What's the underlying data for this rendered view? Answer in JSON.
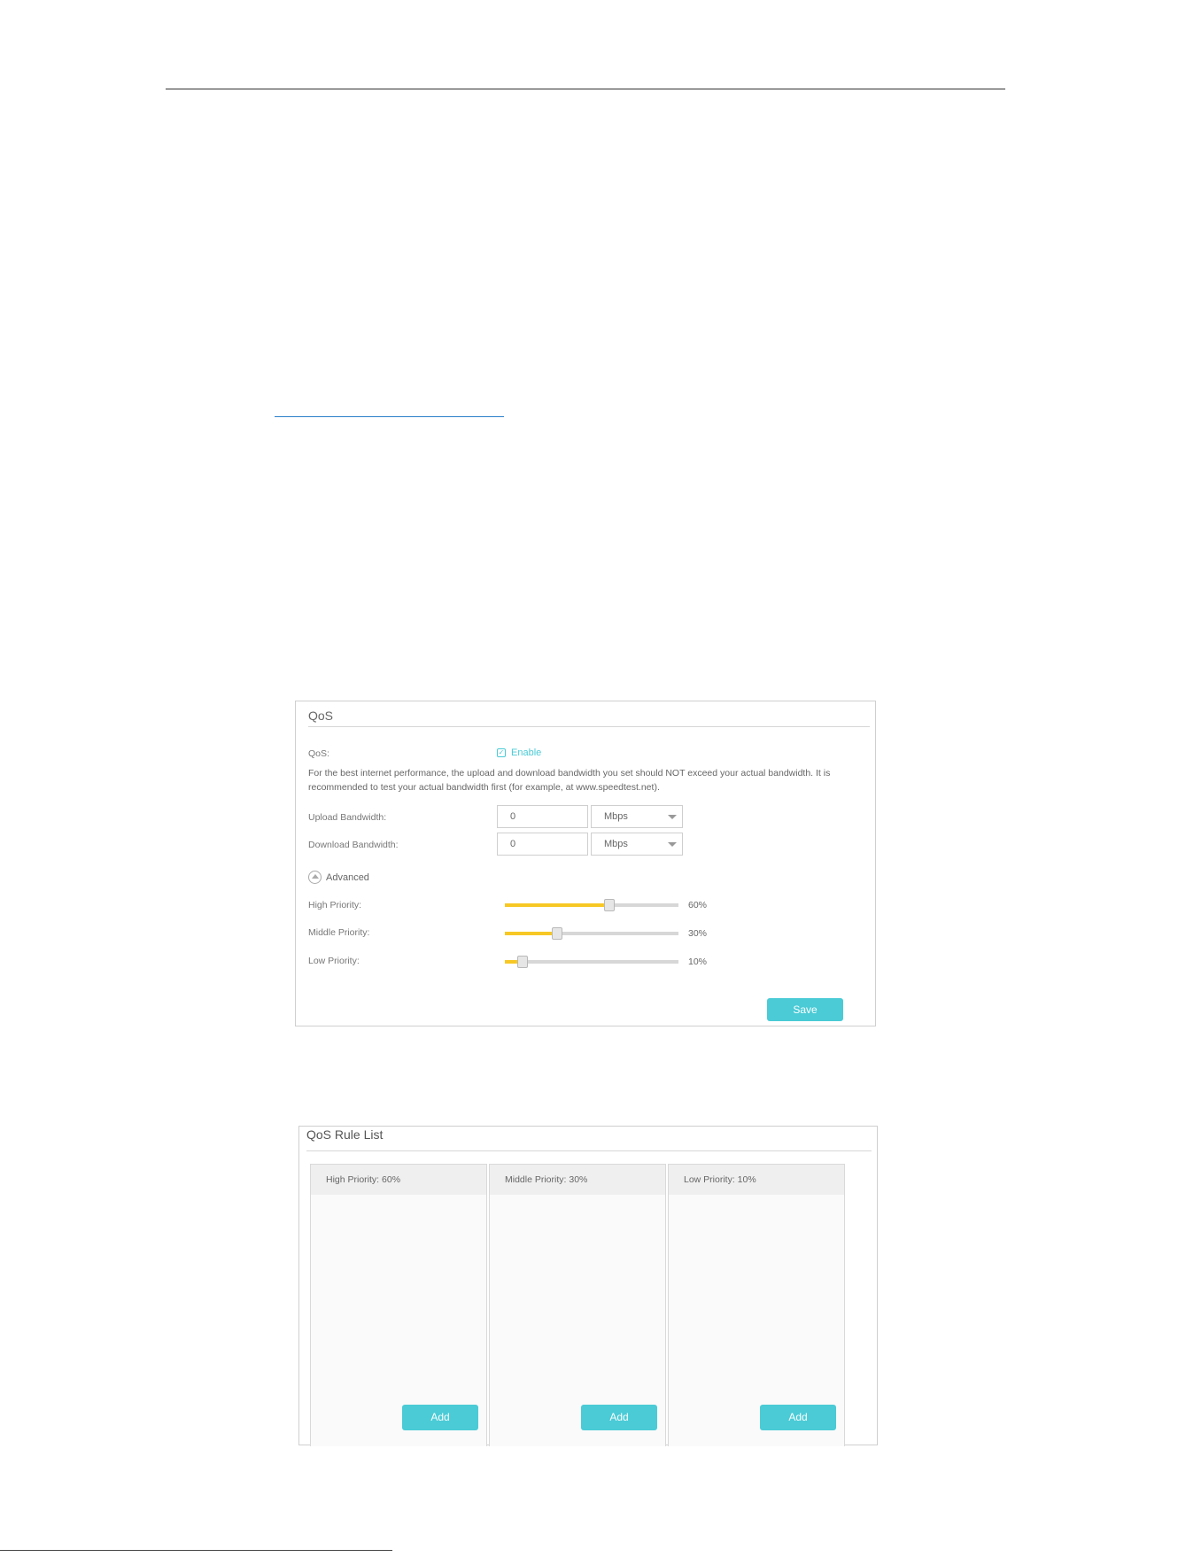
{
  "qos_panel": {
    "title": "QoS",
    "qos_label": "QoS:",
    "enable_label": "Enable",
    "enabled": true,
    "note": "For the best internet performance, the upload and download bandwidth you set should NOT exceed your actual bandwidth. It is recommended to test your actual bandwidth first (for example, at www.speedtest.net).",
    "upload_label": "Upload Bandwidth:",
    "upload_value": "0",
    "upload_unit": "Mbps",
    "download_label": "Download Bandwidth:",
    "download_value": "0",
    "download_unit": "Mbps",
    "advanced_label": "Advanced",
    "priorities": [
      {
        "label": "High Priority:",
        "value": "60%",
        "level": 60
      },
      {
        "label": "Middle Priority:",
        "value": "30%",
        "level": 30
      },
      {
        "label": "Low Priority:",
        "value": "10%",
        "level": 10
      }
    ],
    "save_label": "Save"
  },
  "rule_list": {
    "title": "QoS Rule List",
    "columns": [
      {
        "header": "High Priority: 60%",
        "add_label": "Add"
      },
      {
        "header": "Middle Priority: 30%",
        "add_label": "Add"
      },
      {
        "header": "Low Priority: 10%",
        "add_label": "Add"
      }
    ]
  },
  "colors": {
    "accent": "#4acbd6",
    "slider_fill": "#f7c825",
    "slider_track": "#d7d7d7"
  }
}
